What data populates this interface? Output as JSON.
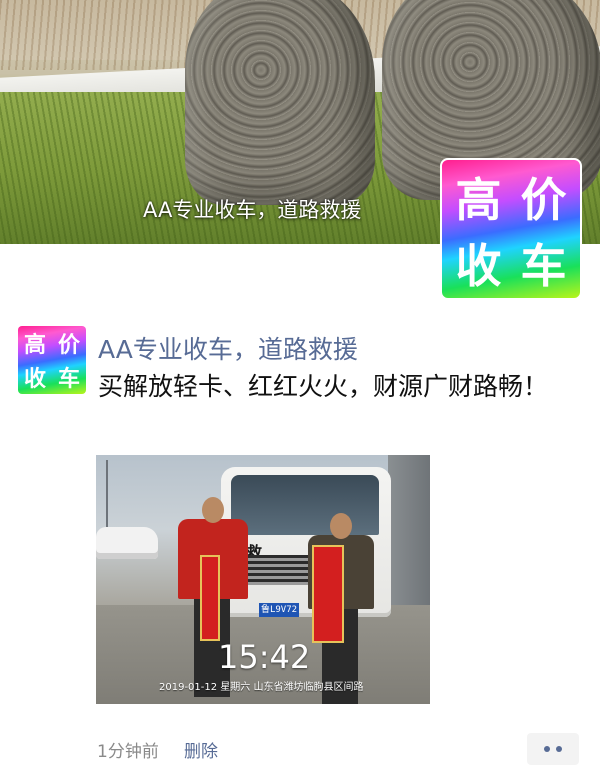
{
  "cover": {
    "caption": "AA专业收车，道路救援",
    "avatar_glyphs": [
      "高",
      "价",
      "收",
      "车"
    ]
  },
  "post": {
    "author": "AA专业收车，道路救援",
    "avatar_glyphs": [
      "高",
      "价",
      "收",
      "车"
    ],
    "text": "买解放轻卡、红红火火，财源广财路畅！",
    "photo": {
      "cab_text": "救",
      "plate": "鲁L9V72",
      "time": "15:42",
      "stamp": "2019-01-12 星期六   山东省潍坊临朐县区间路"
    },
    "time_ago": "1分钟前",
    "delete_label": "删除"
  },
  "colors": {
    "link": "#576b95",
    "meta": "#8a8a8a"
  }
}
